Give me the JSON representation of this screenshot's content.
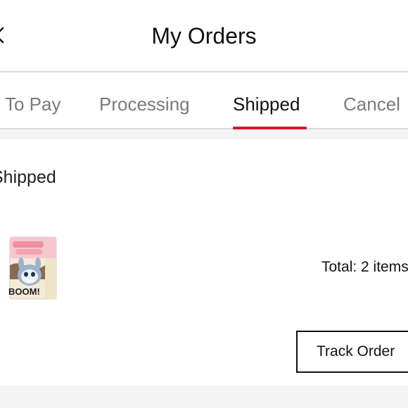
{
  "header": {
    "title": "My Orders",
    "back_icon": "chevron-left-icon"
  },
  "tabs": [
    {
      "label": "To Pay",
      "active": false
    },
    {
      "label": "Processing",
      "active": false
    },
    {
      "label": "Shipped",
      "active": true
    },
    {
      "label": "Cancel",
      "active": false
    }
  ],
  "order": {
    "status": "Shipped",
    "total_label": "Total: 2 items",
    "track_button_label": "Track Order",
    "product_image_text": "BOOM!"
  },
  "colors": {
    "accent": "#d8172b",
    "tab_inactive": "#7a7a7a",
    "divider": "#d9d9d9",
    "background_gap": "#f4f4f4"
  }
}
